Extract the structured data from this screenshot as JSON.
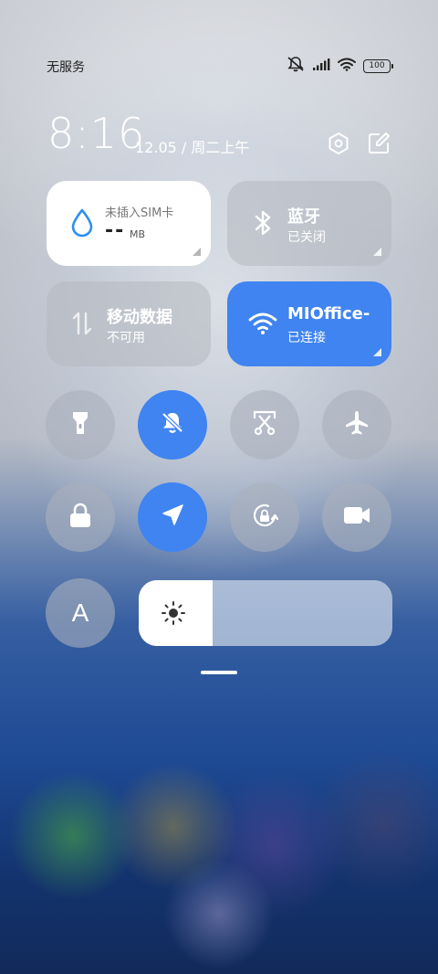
{
  "status_bar": {
    "carrier": "无服务",
    "battery": "100",
    "icons": [
      "mute-icon",
      "signal-icon",
      "wifi-icon",
      "battery-icon"
    ]
  },
  "header": {
    "time": "8:16",
    "date": "12.05 / 周二上午",
    "icons": [
      "settings-icon",
      "edit-icon"
    ]
  },
  "tiles": {
    "data_usage": {
      "title": "未插入SIM卡",
      "value": "--",
      "unit": "MB",
      "icon": "water-drop-icon"
    },
    "bluetooth": {
      "title": "蓝牙",
      "subtitle": "已关闭",
      "icon": "bluetooth-icon"
    },
    "mobile_data": {
      "title": "移动数据",
      "subtitle": "不可用",
      "icon": "mobile-data-icon"
    },
    "wifi": {
      "title": "MIOffice-",
      "subtitle": "已连接",
      "icon": "wifi-icon"
    }
  },
  "toggles_row1": [
    {
      "name": "flashlight",
      "icon": "flashlight-icon",
      "active": false
    },
    {
      "name": "mute",
      "icon": "bell-icon",
      "active": true
    },
    {
      "name": "screenshot",
      "icon": "screenshot-icon",
      "active": false
    },
    {
      "name": "airplane",
      "icon": "airplane-icon",
      "active": false
    }
  ],
  "toggles_row2": [
    {
      "name": "lock",
      "icon": "lock-icon",
      "active": false
    },
    {
      "name": "location",
      "icon": "location-icon",
      "active": true
    },
    {
      "name": "rotation-lock",
      "icon": "rotation-lock-icon",
      "active": false
    },
    {
      "name": "screen-record",
      "icon": "video-icon",
      "active": false
    }
  ],
  "bottom": {
    "font_button_label": "A",
    "brightness_level": 0.29,
    "brightness_icon": "sun-icon"
  },
  "colors": {
    "accent": "#3f84f0",
    "tile_white": "#ffffff",
    "drop_icon": "#2e8ff0"
  }
}
